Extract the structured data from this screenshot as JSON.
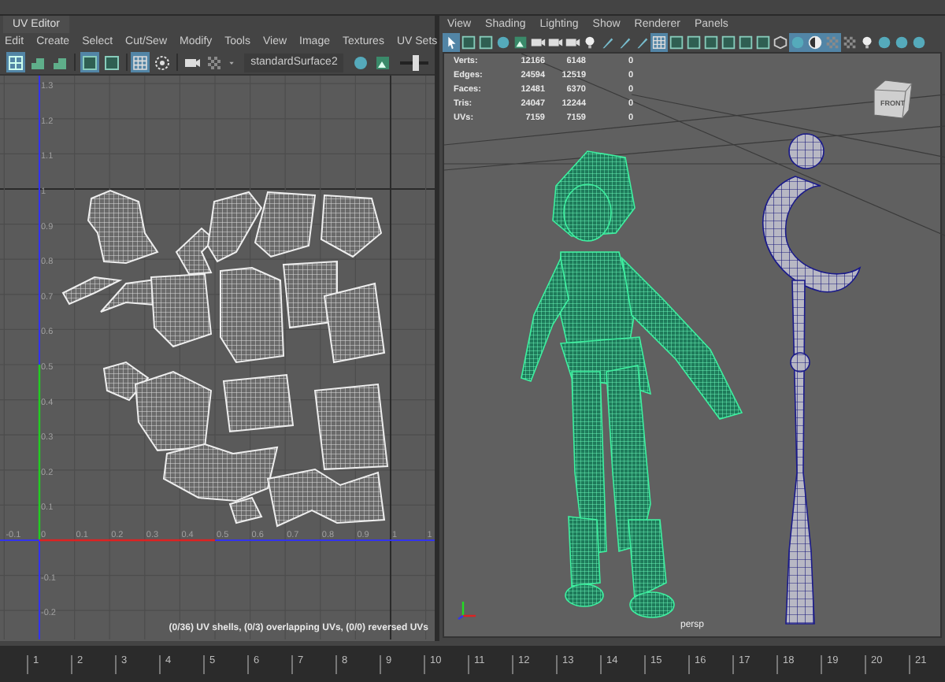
{
  "uv_editor": {
    "title": "UV Editor",
    "menu": [
      "Edit",
      "Create",
      "Select",
      "Cut/Sew",
      "Modify",
      "Tools",
      "View",
      "Image",
      "Textures",
      "UV Sets"
    ],
    "toolbar": [
      {
        "kind": "uv-grid",
        "selected": true
      },
      {
        "kind": "shell",
        "selected": false
      },
      {
        "kind": "shell",
        "selected": false
      },
      {
        "kind": "square-frame",
        "selected": true
      },
      {
        "kind": "square-frame",
        "selected": false
      },
      {
        "kind": "grid",
        "selected": true
      },
      {
        "kind": "target",
        "selected": false
      },
      {
        "kind": "camera",
        "selected": false
      }
    ],
    "material": "standardSurface2",
    "slider": {
      "level": 0.55
    },
    "v_ticks": [
      "1.3",
      "1.2",
      "1.1",
      "1",
      "0.9",
      "0.8",
      "0.7",
      "0.6",
      "0.5",
      "0.4",
      "0.3",
      "0.2",
      "0.1",
      "-0.1",
      "-0.2"
    ],
    "u_ticks": [
      "-0.1",
      "0",
      "0.1",
      "0.2",
      "0.3",
      "0.4",
      "0.5",
      "0.6",
      "0.7",
      "0.8",
      "0.9",
      "1",
      "1"
    ],
    "status": "(0/36) UV shells, (0/3) overlapping UVs, (0/0) reversed UVs"
  },
  "viewport": {
    "menu": [
      "View",
      "Shading",
      "Lighting",
      "Show",
      "Renderer",
      "Panels"
    ],
    "toolbar": [
      {
        "kind": "select",
        "selected": true
      },
      {
        "kind": "square-frame",
        "selected": false
      },
      {
        "kind": "square-frame",
        "selected": false
      },
      {
        "kind": "sphere",
        "selected": false
      },
      {
        "kind": "image",
        "selected": false
      },
      {
        "kind": "camera",
        "selected": false
      },
      {
        "kind": "camera",
        "selected": false
      },
      {
        "kind": "camera",
        "selected": false
      },
      {
        "kind": "light",
        "selected": false
      },
      {
        "kind": "pen",
        "selected": false
      },
      {
        "kind": "pen",
        "selected": false
      },
      {
        "kind": "pen",
        "selected": false
      },
      {
        "kind": "grid",
        "selected": true
      },
      {
        "kind": "square-frame",
        "selected": false
      },
      {
        "kind": "square-frame",
        "selected": false
      },
      {
        "kind": "square-frame",
        "selected": false
      },
      {
        "kind": "square-frame",
        "selected": false
      },
      {
        "kind": "square-frame",
        "selected": false
      },
      {
        "kind": "square-frame",
        "selected": false
      },
      {
        "kind": "cube",
        "selected": false
      },
      {
        "kind": "sphere",
        "selected": true
      },
      {
        "kind": "half-circle",
        "selected": true
      },
      {
        "kind": "checker",
        "selected": true
      },
      {
        "kind": "checker",
        "selected": false
      },
      {
        "kind": "light",
        "selected": false
      },
      {
        "kind": "sphere",
        "selected": false
      },
      {
        "kind": "sphere",
        "selected": false
      },
      {
        "kind": "sphere",
        "selected": false
      }
    ],
    "stats": [
      {
        "label": "Verts:",
        "values": [
          "12166",
          "6148",
          "0"
        ]
      },
      {
        "label": "Edges:",
        "values": [
          "24594",
          "12519",
          "0"
        ]
      },
      {
        "label": "Faces:",
        "values": [
          "12481",
          "6370",
          "0"
        ]
      },
      {
        "label": "Tris:",
        "values": [
          "24047",
          "12244",
          "0"
        ]
      },
      {
        "label": "UVs:",
        "values": [
          "7159",
          "7159",
          "0"
        ]
      }
    ],
    "view_cube": "FRONT",
    "camera": "persp"
  },
  "time_slider": {
    "frames": [
      "1",
      "2",
      "3",
      "4",
      "5",
      "6",
      "7",
      "8",
      "9",
      "10",
      "11",
      "12",
      "13",
      "14",
      "15",
      "16",
      "17",
      "18",
      "19",
      "20",
      "21"
    ]
  }
}
